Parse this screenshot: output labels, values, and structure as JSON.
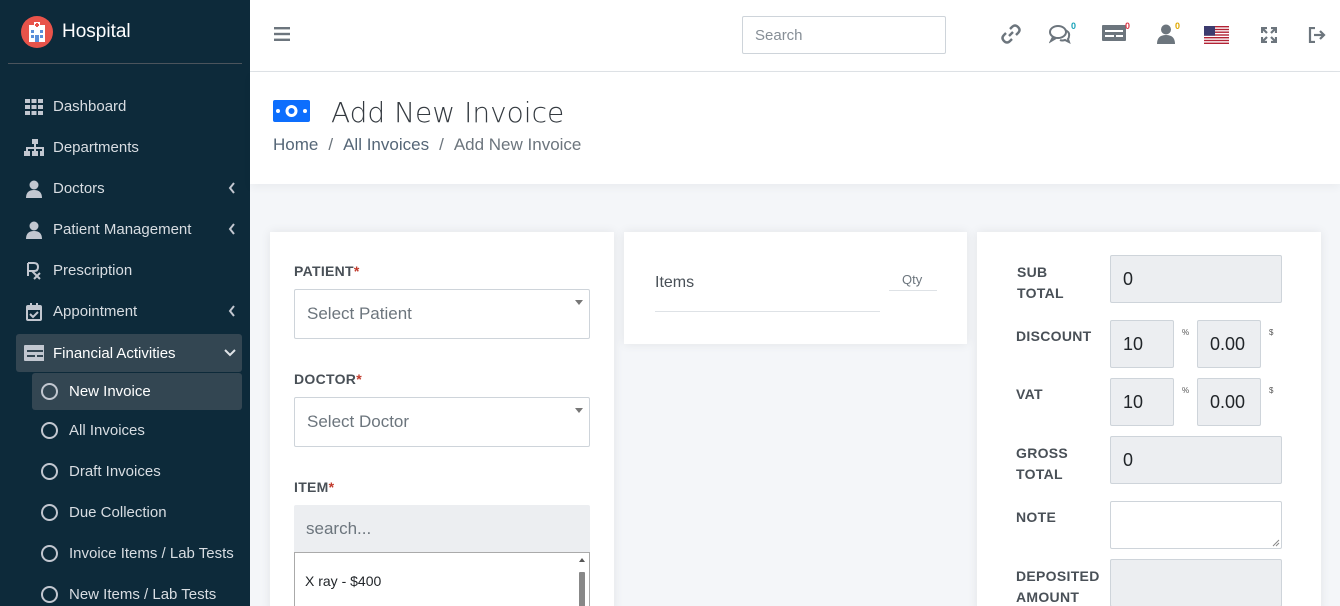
{
  "sidebar": {
    "brand": "Hospital",
    "items": [
      {
        "label": "Dashboard"
      },
      {
        "label": "Departments"
      },
      {
        "label": "Doctors"
      },
      {
        "label": "Patient Management"
      },
      {
        "label": "Prescription"
      },
      {
        "label": "Appointment"
      },
      {
        "label": "Financial Activities"
      }
    ],
    "subitems": [
      {
        "label": "New Invoice"
      },
      {
        "label": "All Invoices"
      },
      {
        "label": "Draft Invoices"
      },
      {
        "label": "Due Collection"
      },
      {
        "label": "Invoice Items / Lab Tests"
      },
      {
        "label": "New Items / Lab Tests"
      }
    ]
  },
  "topbar": {
    "search_placeholder": "Search",
    "badges": {
      "messages": "0",
      "billing": "0",
      "users": "0"
    }
  },
  "header": {
    "title": "Add New Invoice",
    "breadcrumb": [
      "Home",
      "All Invoices",
      "Add New Invoice"
    ]
  },
  "form": {
    "patient_label": "PATIENT",
    "patient_placeholder": "Select Patient",
    "doctor_label": "DOCTOR",
    "doctor_placeholder": "Select Doctor",
    "item_label": "ITEM",
    "item_search_placeholder": "search...",
    "item_options": [
      "X ray - $400"
    ],
    "required_mark": "*"
  },
  "items_table": {
    "items_header": "Items",
    "qty_header": "Qty"
  },
  "totals": {
    "sub_total_label_1": "SUB",
    "sub_total_label_2": "TOTAL",
    "sub_total": "0",
    "discount_label": "DISCOUNT",
    "discount_percent": "10",
    "discount_amount": "0.00",
    "vat_label": "VAT",
    "vat_percent": "10",
    "vat_amount": "0.00",
    "percent_unit": "%",
    "dollar_unit": "$",
    "gross_total_label_1": "GROSS",
    "gross_total_label_2": "TOTAL",
    "gross_total": "0",
    "note_label": "NOTE",
    "deposited_label_1": "DEPOSITED",
    "deposited_label_2": "AMOUNT"
  }
}
